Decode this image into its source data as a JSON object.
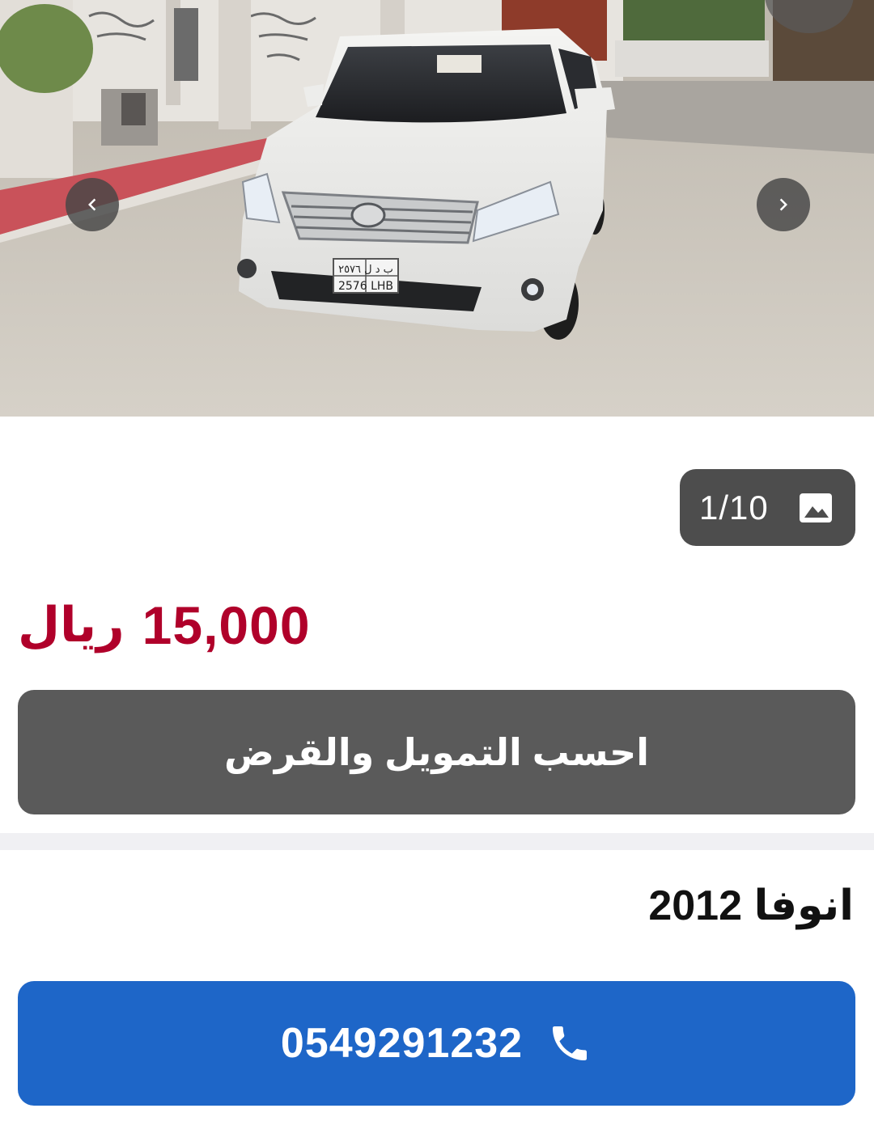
{
  "gallery": {
    "photo": "white-toyota-minivan-photo",
    "plate_text_top": "ب د ل ٢٥٧٦",
    "plate_text_bottom": "2576 LHB",
    "prev_icon": "chevron-left-icon",
    "next_icon": "chevron-right-icon"
  },
  "counter": {
    "text": "1/10",
    "icon": "image-icon"
  },
  "price": {
    "amount": "15,000",
    "currency": "ريال",
    "color": "#b0002a"
  },
  "finance_button": {
    "label": "احسب التمويل والقرض",
    "color": "#5a5a5a"
  },
  "listing": {
    "title": "انوفا 2012"
  },
  "call_button": {
    "phone": "0549291232",
    "icon": "phone-icon",
    "color": "#1e66c8"
  }
}
